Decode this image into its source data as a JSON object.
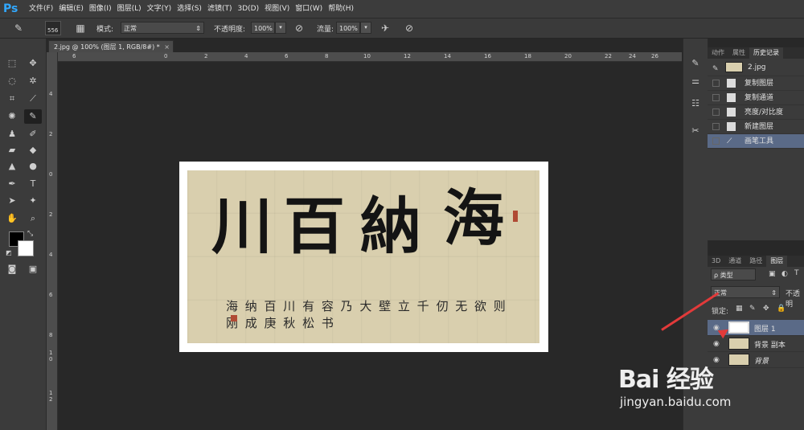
{
  "app": {
    "logo": "Ps"
  },
  "menu": [
    "文件(F)",
    "编辑(E)",
    "图像(I)",
    "图层(L)",
    "文字(Y)",
    "选择(S)",
    "滤镜(T)",
    "3D(D)",
    "视图(V)",
    "窗口(W)",
    "帮助(H)"
  ],
  "options": {
    "brush_size": "556",
    "mode_label": "模式:",
    "mode_value": "正常",
    "opacity_label": "不透明度:",
    "opacity_value": "100%",
    "flow_label": "流量:",
    "flow_value": "100%"
  },
  "document": {
    "tab_title": "2.jpg @ 100% (图层 1, RGB/8#) *",
    "close": "×",
    "ruler_top": [
      "6",
      "0",
      "2",
      "4",
      "6",
      "8",
      "10",
      "12",
      "14",
      "16",
      "18",
      "20",
      "22",
      "24",
      "26"
    ],
    "ruler_left": [
      "4",
      "2",
      "0",
      "2",
      "4",
      "6",
      "8",
      "1 0",
      "1 2"
    ]
  },
  "artwork": {
    "main_chars": [
      "川",
      "百",
      "納",
      "海"
    ],
    "inscription": "海 纳 百 川 有 容 乃 大 壁 立 千 仞 无 欲 则 刚 成 庚 秋 松 书"
  },
  "history_panel": {
    "tabs": [
      "动作",
      "属性",
      "历史记录"
    ],
    "snapshot": "2.jpg",
    "items": [
      "复制图层",
      "复制通道",
      "亮度/对比度",
      "新建图层",
      "画笔工具"
    ]
  },
  "layers_panel": {
    "tabs": [
      "3D",
      "通道",
      "路径",
      "图层"
    ],
    "filter_label": "ρ 类型",
    "blend_mode": "正常",
    "opacity_label": "不透明",
    "lock_label": "锁定:",
    "layers": [
      "图层 1",
      "背景 副本",
      "背景"
    ]
  },
  "watermark": {
    "logo": "Bai 经验",
    "url": "jingyan.baidu.com"
  },
  "colors": {
    "accent": "#31a8ff",
    "selection": "#5a6a87",
    "arrow": "#e23a3a"
  }
}
